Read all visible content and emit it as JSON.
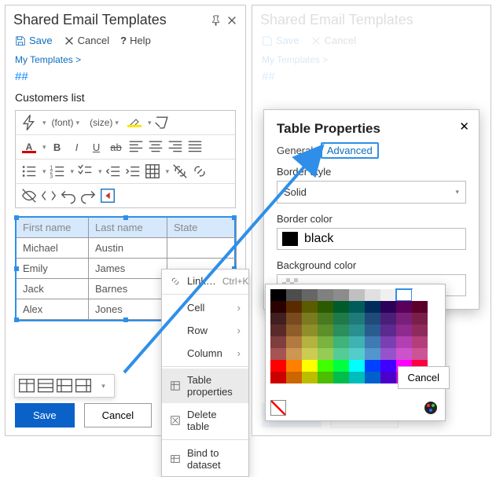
{
  "header": {
    "title": "Shared Email Templates"
  },
  "toolbar": {
    "save": "Save",
    "cancel": "Cancel",
    "help": "Help"
  },
  "breadcrumb": "My Templates >",
  "hash": "##",
  "docTitle": "Customers list",
  "editor": {
    "font_label": "(font)",
    "size_label": "(size)"
  },
  "table": {
    "headers": [
      "First name",
      "Last name",
      "State"
    ],
    "rows": [
      [
        "Michael",
        "Austin",
        ""
      ],
      [
        "Emily",
        "James",
        ""
      ],
      [
        "Jack",
        "Barnes",
        ""
      ],
      [
        "Alex",
        "Jones",
        ""
      ]
    ]
  },
  "context": {
    "link": "Link…",
    "link_kb": "Ctrl+K",
    "cell": "Cell",
    "row": "Row",
    "column": "Column",
    "tprops": "Table properties",
    "del": "Delete table",
    "bind": "Bind to dataset"
  },
  "footer": {
    "save": "Save",
    "cancel": "Cancel"
  },
  "dialog": {
    "title": "Table Properties",
    "tab_general": "General",
    "tab_advanced": "Advanced",
    "border_style_lbl": "Border style",
    "border_style_val": "Solid",
    "border_color_lbl": "Border color",
    "border_color_val": "black",
    "bg_lbl": "Background color",
    "cancel": "Cancel"
  },
  "palette": {
    "rows": [
      [
        "#000000",
        "#4d4d4d",
        "#666666",
        "#808080",
        "#8c8c8c",
        "#c0c0c0",
        "#e0e0e0",
        "#f0f0f0",
        "#ffffff",
        "#ffffff"
      ],
      [
        "#2a0000",
        "#5b2b00",
        "#5b5b00",
        "#2b5b00",
        "#005b2b",
        "#005b5b",
        "#002b5b",
        "#2b005b",
        "#5b005b",
        "#5b002b"
      ],
      [
        "#3f1f1f",
        "#7a4a1f",
        "#7a7a1f",
        "#4a7a1f",
        "#1f7a4a",
        "#1f7a7a",
        "#1f4a7a",
        "#4a1f7a",
        "#7a1f7a",
        "#7a1f4a"
      ],
      [
        "#5a2a2a",
        "#8f5d2a",
        "#8f8f2a",
        "#5d8f2a",
        "#2a8f5d",
        "#2a8f8f",
        "#2a5d8f",
        "#5d2a8f",
        "#8f2a8f",
        "#8f2a5d"
      ],
      [
        "#7f3f3f",
        "#b37a3f",
        "#b3b33f",
        "#7ab33f",
        "#3fb37a",
        "#3fb3b3",
        "#3f7ab3",
        "#7a3fb3",
        "#b33fb3",
        "#b33f7a"
      ],
      [
        "#a65353",
        "#cc9653",
        "#cccc53",
        "#96cc53",
        "#53cc96",
        "#53cccc",
        "#5396cc",
        "#9653cc",
        "#cc53cc",
        "#cc5396"
      ],
      [
        "#ff0000",
        "#ff8000",
        "#ffff00",
        "#40ff00",
        "#00ff40",
        "#00ffff",
        "#0040ff",
        "#4000ff",
        "#ff00ff",
        "#ff0040"
      ],
      [
        "#cc0000",
        "#cc6600",
        "#bdbd00",
        "#4cbd00",
        "#00bd4c",
        "#00bdbd",
        "#0060cc",
        "#4c00cc",
        "#cc00cc",
        "#cc004c"
      ]
    ],
    "selected": [
      0,
      8
    ]
  }
}
